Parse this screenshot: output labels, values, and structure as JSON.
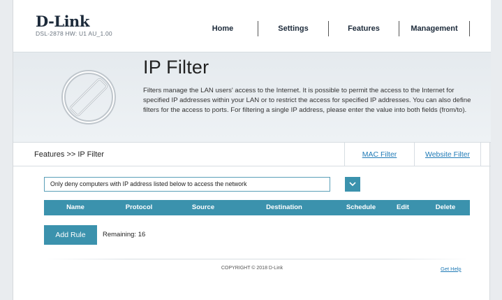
{
  "header": {
    "logo_text": "D-Link",
    "logo_sub": "DSL-2878  HW: U1   AU_1.00",
    "nav": [
      {
        "label": "Home"
      },
      {
        "label": "Settings"
      },
      {
        "label": "Features"
      },
      {
        "label": "Management"
      }
    ]
  },
  "banner": {
    "title": "IP Filter",
    "description": "Filters manage the LAN users' access to the Internet. It is possible to permit the access to the Internet for specified IP addresses within your LAN or to restrict the access for specified IP addresses. You can also define filters for the access to ports. For filtering a single IP address, please enter the value into both fields (from/to)."
  },
  "subbar": {
    "breadcrumb": "Features >> IP Filter",
    "tabs": [
      {
        "label": "MAC Filter"
      },
      {
        "label": "Website Filter"
      }
    ]
  },
  "filter_mode": {
    "selected": "Only deny computers with IP address listed below to access the network"
  },
  "table": {
    "columns": [
      "Name",
      "Protocol",
      "Source",
      "Destination",
      "Schedule",
      "Edit",
      "Delete"
    ]
  },
  "actions": {
    "add_rule": "Add Rule",
    "remaining": "Remaining: 16"
  },
  "footer": {
    "copyright": "COPYRIGHT © 2018 D-Link",
    "help": "Get Help"
  },
  "colors": {
    "accent": "#3b92ad",
    "link": "#1f7ab6"
  }
}
